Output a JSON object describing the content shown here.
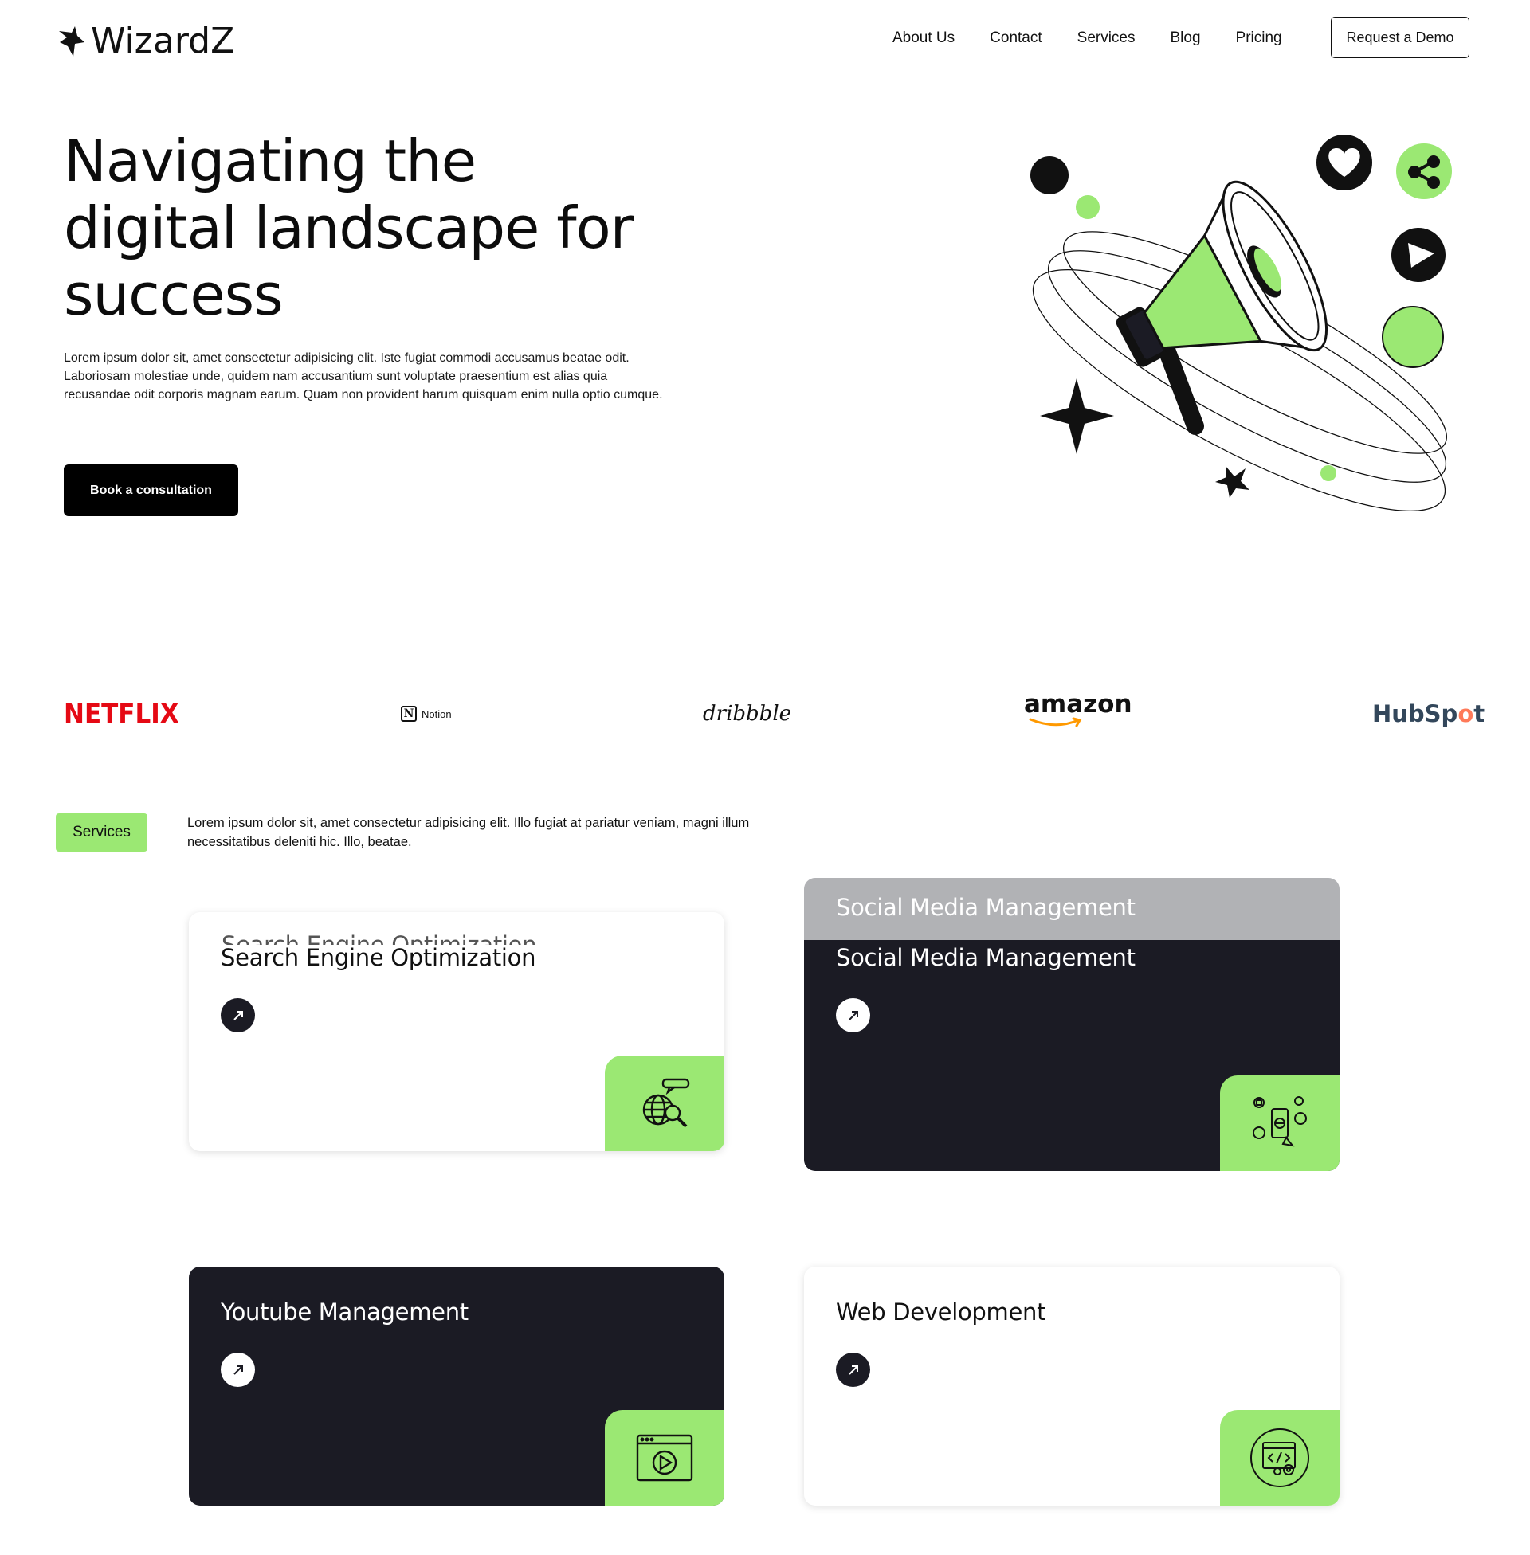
{
  "header": {
    "brand": "WizardZ",
    "nav": [
      "About Us",
      "Contact",
      "Services",
      "Blog",
      "Pricing"
    ],
    "cta": "Request a Demo"
  },
  "hero": {
    "title_lines": [
      "Navigating the",
      "digital landscape for",
      "success"
    ],
    "description": "Lorem ipsum dolor sit, amet consectetur adipisicing elit. Iste fugiat commodi accusamus beatae odit. Laboriosam molestiae unde, quidem nam accusantium sunt voluptate praesentium est alias quia recusandae odit corporis magnam earum. Quam non provident harum quisquam enim nulla optio cumque.",
    "button": "Book a consultation"
  },
  "brands": {
    "netflix": "NETFLIX",
    "notion": "Notion",
    "notion_mark": "N",
    "dribbble": "dribbble",
    "amazon": "amazon",
    "hubspot_a": "HubSp",
    "hubspot_o": "o",
    "hubspot_b": "t"
  },
  "services": {
    "badge": "Services",
    "description": "Lorem ipsum dolor sit, amet consectetur adipisicing elit. Illo fugiat at pariatur veniam, magni illum necessitatibus deleniti hic. Illo, beatae.",
    "cards": [
      {
        "title": "Search Engine Optimization",
        "theme": "light",
        "icon": "globe-search-icon"
      },
      {
        "title": "Social Media Management",
        "theme": "dark",
        "icon": "social-media-icon"
      },
      {
        "title": "Youtube Management",
        "theme": "dark",
        "icon": "video-player-icon"
      },
      {
        "title": "Web Development",
        "theme": "light",
        "icon": "code-settings-icon"
      }
    ]
  },
  "colors": {
    "accent_green": "#9be873",
    "dark_card": "#1b1b24",
    "netflix_red": "#e50914",
    "hubspot_orange": "#ff7a59"
  }
}
